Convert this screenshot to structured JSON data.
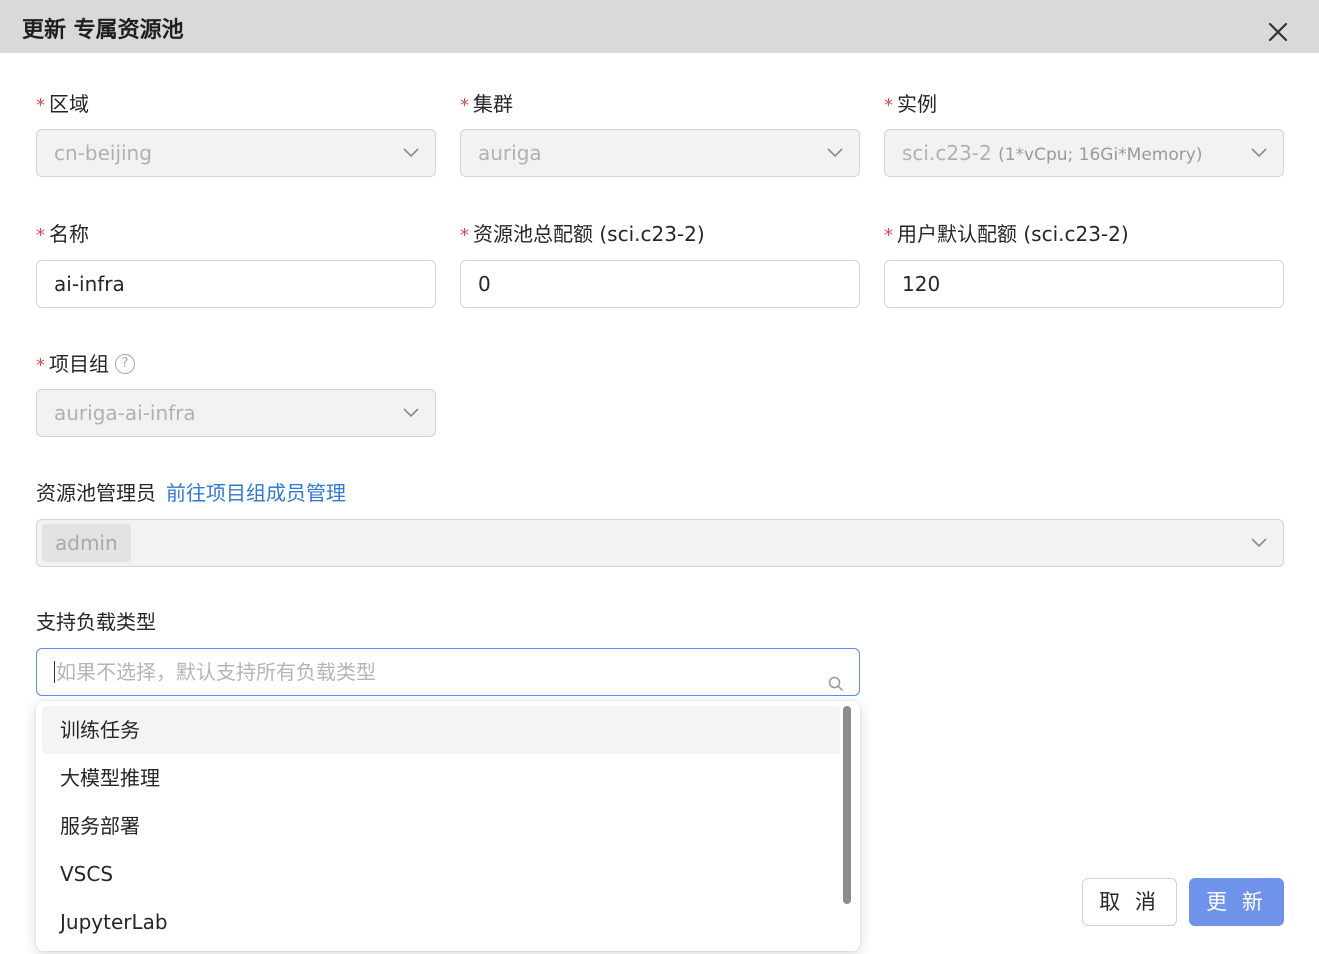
{
  "dialog": {
    "title": "更新 专属资源池",
    "cancel_label": "取 消",
    "submit_label": "更 新"
  },
  "fields": {
    "region": {
      "label": "区域",
      "value": "cn-beijing"
    },
    "cluster": {
      "label": "集群",
      "value": "auriga"
    },
    "instance": {
      "label": "实例",
      "value": "sci.c23-2",
      "detail": "(1*vCpu; 16Gi*Memory)"
    },
    "name": {
      "label": "名称",
      "value": "ai-infra"
    },
    "pool_quota": {
      "label": "资源池总配额 (sci.c23-2)",
      "value": "0"
    },
    "user_quota": {
      "label": "用户默认配额 (sci.c23-2)",
      "value": "120"
    },
    "project_group": {
      "label": "项目组",
      "value": "auriga-ai-infra",
      "help_icon": "question-circle-icon"
    },
    "admins": {
      "label": "资源池管理员",
      "link": "前往项目组成员管理",
      "tags": [
        "admin"
      ]
    },
    "workload_types": {
      "label": "支持负载类型",
      "placeholder": "如果不选择，默认支持所有负载类型",
      "options": [
        "训练任务",
        "大模型推理",
        "服务部署",
        "VSCS",
        "JupyterLab"
      ],
      "active_option": "训练任务"
    }
  },
  "required_marker": "*",
  "colors": {
    "header_bg": "#d9d9db",
    "required": "#e5484d",
    "link": "#2f7ad8",
    "primary": "#6f93ea",
    "focus_border": "#5b8cf5"
  },
  "icons": {
    "close": "close-icon",
    "chevron": "chevron-down-icon",
    "search": "search-icon"
  }
}
